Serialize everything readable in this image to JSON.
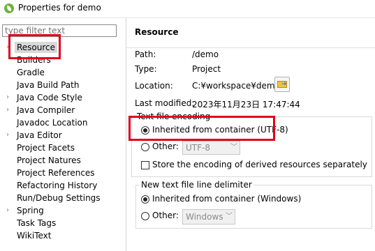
{
  "window": {
    "title": "Properties for demo"
  },
  "filter": {
    "placeholder": "type filter text"
  },
  "tree": {
    "items": [
      {
        "label": "Resource",
        "expandable": true,
        "selected": true
      },
      {
        "label": "Builders",
        "expandable": false
      },
      {
        "label": "Gradle",
        "expandable": false
      },
      {
        "label": "Java Build Path",
        "expandable": false
      },
      {
        "label": "Java Code Style",
        "expandable": true
      },
      {
        "label": "Java Compiler",
        "expandable": true
      },
      {
        "label": "Javadoc Location",
        "expandable": false
      },
      {
        "label": "Java Editor",
        "expandable": true
      },
      {
        "label": "Project Facets",
        "expandable": false
      },
      {
        "label": "Project Natures",
        "expandable": false
      },
      {
        "label": "Project References",
        "expandable": false
      },
      {
        "label": "Refactoring History",
        "expandable": false
      },
      {
        "label": "Run/Debug Settings",
        "expandable": false
      },
      {
        "label": "Spring",
        "expandable": true
      },
      {
        "label": "Task Tags",
        "expandable": false
      },
      {
        "label": "WikiText",
        "expandable": false
      }
    ]
  },
  "resource": {
    "heading": "Resource",
    "path_label": "Path:",
    "path_value": "/demo",
    "type_label": "Type:",
    "type_value": "Project",
    "location_label": "Location:",
    "location_value": "C:¥workspace¥demo",
    "modified_label": "Last modified:",
    "modified_value": "2023年11月23日 17:47:44"
  },
  "encoding": {
    "legend": "Text file encoding",
    "inherited_label": "Inherited from container (UTF-8)",
    "other_label": "Other:",
    "other_value": "UTF-8",
    "derived_label": "Store the encoding of derived resources separately"
  },
  "delimiter": {
    "legend": "New text file line delimiter",
    "inherited_label": "Inherited from container (Windows)",
    "other_label": "Other:",
    "other_value": "Windows"
  },
  "colors": {
    "highlight": "#e0001b",
    "selection": "#d9d9d9",
    "spring_green": "#6db33f"
  }
}
